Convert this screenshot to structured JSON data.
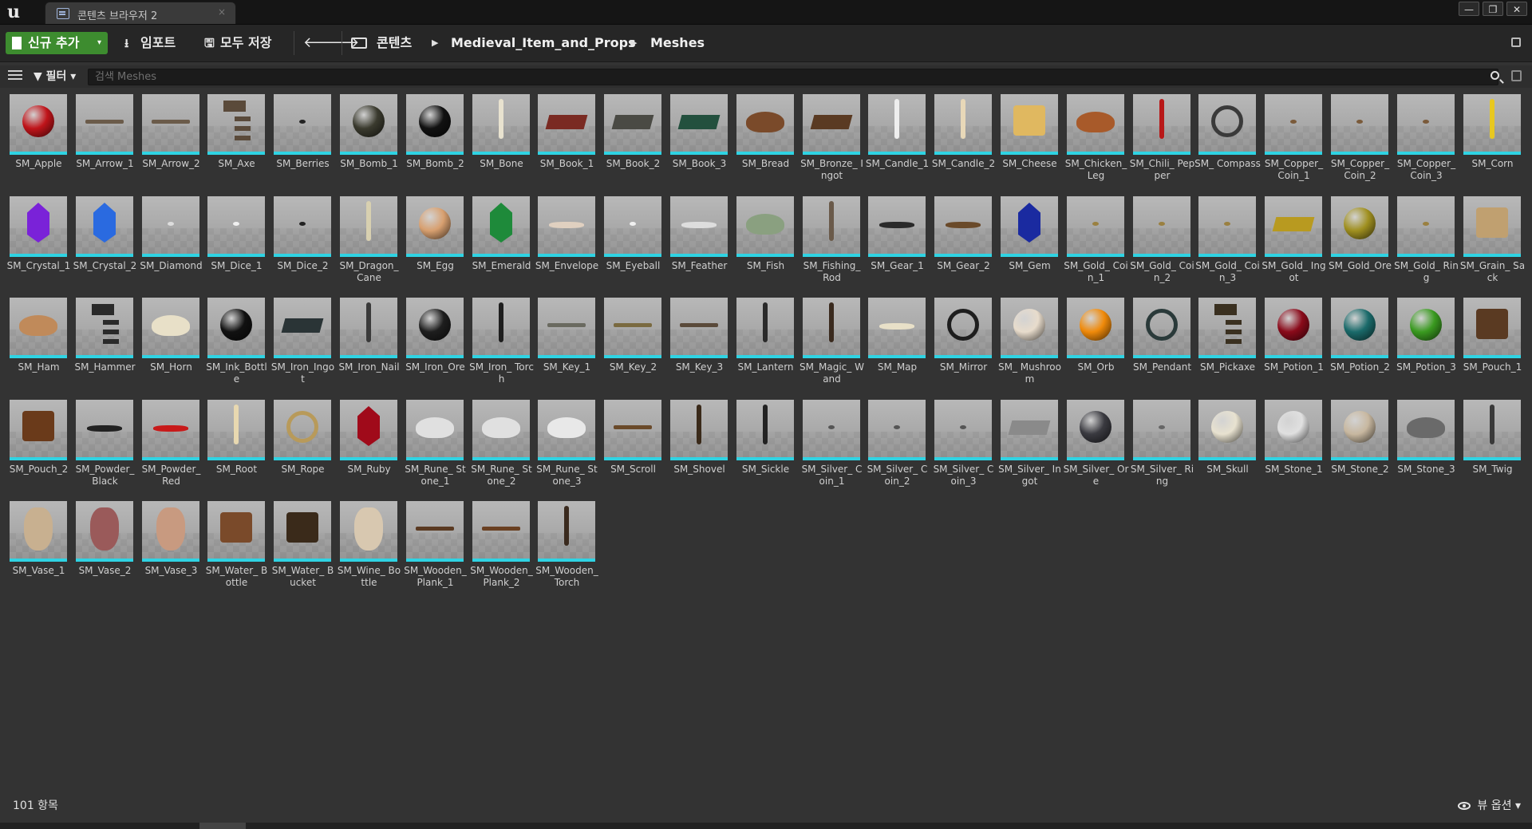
{
  "window": {
    "tab_title": "콘텐츠 브라우저 2",
    "tab_close": "×",
    "minimize": "—",
    "maximize": "❐",
    "close": "✕"
  },
  "toolbar": {
    "add_new": "신규 추가",
    "add_new_caret": "▾",
    "import": "임포트",
    "save_all": "모두 저장",
    "back": "🡐",
    "forward": "🡒",
    "breadcrumbs": [
      "콘텐츠",
      "Medieval_Item_and_Props",
      "Meshes"
    ],
    "crumb_separator": "▶"
  },
  "filter": {
    "label": "필터",
    "search_placeholder": "검색 Meshes"
  },
  "assets": [
    {
      "name": "SM_Apple",
      "shape": "ball",
      "color": "#c0141a"
    },
    {
      "name": "SM_Arrow_1",
      "shape": "stick-h",
      "color": "#6b5b4a"
    },
    {
      "name": "SM_Arrow_2",
      "shape": "stick-h",
      "color": "#6b5b4a"
    },
    {
      "name": "SM_Axe",
      "shape": "axe",
      "color": "#5a4a3a"
    },
    {
      "name": "SM_Berries",
      "shape": "tiny",
      "color": "#222222"
    },
    {
      "name": "SM_Bomb_1",
      "shape": "ball",
      "color": "#3a3a2e"
    },
    {
      "name": "SM_Bomb_2",
      "shape": "ball",
      "color": "#111111"
    },
    {
      "name": "SM_Bone",
      "shape": "stick-v",
      "color": "#e8e2cf"
    },
    {
      "name": "SM_Book_1",
      "shape": "slab",
      "color": "#7a2a22"
    },
    {
      "name": "SM_Book_2",
      "shape": "slab",
      "color": "#4a4a44"
    },
    {
      "name": "SM_Book_3",
      "shape": "slab",
      "color": "#23503e"
    },
    {
      "name": "SM_Bread",
      "shape": "loaf",
      "color": "#7a4a2a"
    },
    {
      "name": "SM_Bronze_ Ingot",
      "shape": "slab",
      "color": "#5a3a22"
    },
    {
      "name": "SM_Candle_1",
      "shape": "stick-v",
      "color": "#eeeeee"
    },
    {
      "name": "SM_Candle_2",
      "shape": "stick-v",
      "color": "#e8d8b8"
    },
    {
      "name": "SM_Cheese",
      "shape": "block",
      "color": "#e0b860"
    },
    {
      "name": "SM_Chicken_ Leg",
      "shape": "loaf",
      "color": "#a85a2a"
    },
    {
      "name": "SM_Chili_ Pepper",
      "shape": "stick-v",
      "color": "#b81818"
    },
    {
      "name": "SM_ Compass",
      "shape": "disc",
      "color": "#3a3a3a"
    },
    {
      "name": "SM_Copper_ Coin_1",
      "shape": "tiny",
      "color": "#7a5a3a"
    },
    {
      "name": "SM_Copper_ Coin_2",
      "shape": "tiny",
      "color": "#7a5a3a"
    },
    {
      "name": "SM_Copper_ Coin_3",
      "shape": "tiny",
      "color": "#7a5a3a"
    },
    {
      "name": "SM_Corn",
      "shape": "stick-v",
      "color": "#e8c820"
    },
    {
      "name": "SM_Crystal_1",
      "shape": "gem",
      "color": "#7a22d8"
    },
    {
      "name": "SM_Crystal_2",
      "shape": "gem",
      "color": "#2a6ae0"
    },
    {
      "name": "SM_Diamond",
      "shape": "tiny",
      "color": "#dddddd"
    },
    {
      "name": "SM_Dice_1",
      "shape": "tiny",
      "color": "#f0f0f0"
    },
    {
      "name": "SM_Dice_2",
      "shape": "tiny",
      "color": "#222222"
    },
    {
      "name": "SM_Dragon_ Cane",
      "shape": "stick-v",
      "color": "#d8d0b0"
    },
    {
      "name": "SM_Egg",
      "shape": "ball",
      "color": "#d8a070"
    },
    {
      "name": "SM_Emerald",
      "shape": "gem",
      "color": "#1e8a3a"
    },
    {
      "name": "SM_Envelope",
      "shape": "flat",
      "color": "#e0d0c0"
    },
    {
      "name": "SM_Eyeball",
      "shape": "tiny",
      "color": "#f0f0f0"
    },
    {
      "name": "SM_Feather",
      "shape": "flat",
      "color": "#dddddd"
    },
    {
      "name": "SM_Fish",
      "shape": "loaf",
      "color": "#8aa080"
    },
    {
      "name": "SM_Fishing_ Rod",
      "shape": "stick-v",
      "color": "#6a5a4a"
    },
    {
      "name": "SM_Gear_1",
      "shape": "flat",
      "color": "#2a2a2a"
    },
    {
      "name": "SM_Gear_2",
      "shape": "flat",
      "color": "#6a4a2a"
    },
    {
      "name": "SM_Gem",
      "shape": "gem",
      "color": "#1a2aa0"
    },
    {
      "name": "SM_Gold_ Coin_1",
      "shape": "tiny",
      "color": "#9a8040"
    },
    {
      "name": "SM_Gold_ Coin_2",
      "shape": "tiny",
      "color": "#9a8040"
    },
    {
      "name": "SM_Gold_ Coin_3",
      "shape": "tiny",
      "color": "#9a8040"
    },
    {
      "name": "SM_Gold_ Ingot",
      "shape": "slab",
      "color": "#b89a20"
    },
    {
      "name": "SM_Gold_Ore",
      "shape": "ball",
      "color": "#a09020"
    },
    {
      "name": "SM_Gold_ Ring",
      "shape": "tiny",
      "color": "#9a8040"
    },
    {
      "name": "SM_Grain_ Sack",
      "shape": "block",
      "color": "#c0a070"
    },
    {
      "name": "SM_Ham",
      "shape": "loaf",
      "color": "#c08a5a"
    },
    {
      "name": "SM_Hammer",
      "shape": "axe",
      "color": "#2a2a2a"
    },
    {
      "name": "SM_Horn",
      "shape": "loaf",
      "color": "#e8e0c8"
    },
    {
      "name": "SM_Ink_Bottle",
      "shape": "ball",
      "color": "#111111"
    },
    {
      "name": "SM_Iron_Ingot",
      "shape": "slab",
      "color": "#2a3436"
    },
    {
      "name": "SM_Iron_Nail",
      "shape": "stick-v",
      "color": "#3a3a3a"
    },
    {
      "name": "SM_Iron_Ore",
      "shape": "ball",
      "color": "#1e1e1e"
    },
    {
      "name": "SM_Iron_ Torch",
      "shape": "stick-v",
      "color": "#1e1e1e"
    },
    {
      "name": "SM_Key_1",
      "shape": "stick-h",
      "color": "#6a6a60"
    },
    {
      "name": "SM_Key_2",
      "shape": "stick-h",
      "color": "#7a6a40"
    },
    {
      "name": "SM_Key_3",
      "shape": "stick-h",
      "color": "#5a4a3a"
    },
    {
      "name": "SM_Lantern",
      "shape": "stick-v",
      "color": "#2a2a2a"
    },
    {
      "name": "SM_Magic_ Wand",
      "shape": "stick-v",
      "color": "#3a2a1e"
    },
    {
      "name": "SM_Map",
      "shape": "flat",
      "color": "#e8e0c8"
    },
    {
      "name": "SM_Mirror",
      "shape": "disc",
      "color": "#1e1e1e"
    },
    {
      "name": "SM_ Mushroom",
      "shape": "ball",
      "color": "#e8dccc"
    },
    {
      "name": "SM_Orb",
      "shape": "ball",
      "color": "#f08a0a"
    },
    {
      "name": "SM_Pendant",
      "shape": "disc",
      "color": "#2a3a3a"
    },
    {
      "name": "SM_Pickaxe",
      "shape": "axe",
      "color": "#3a3020"
    },
    {
      "name": "SM_Potion_1",
      "shape": "ball",
      "color": "#8a0a1a"
    },
    {
      "name": "SM_Potion_2",
      "shape": "ball",
      "color": "#1a6a6a"
    },
    {
      "name": "SM_Potion_3",
      "shape": "ball",
      "color": "#3a9a20"
    },
    {
      "name": "SM_Pouch_1",
      "shape": "block",
      "color": "#5a3a22"
    },
    {
      "name": "SM_Pouch_2",
      "shape": "block",
      "color": "#6a3a1a"
    },
    {
      "name": "SM_Powder_ Black",
      "shape": "flat",
      "color": "#222222"
    },
    {
      "name": "SM_Powder_ Red",
      "shape": "flat",
      "color": "#c81a1a"
    },
    {
      "name": "SM_Root",
      "shape": "stick-v",
      "color": "#e8d8b0"
    },
    {
      "name": "SM_Rope",
      "shape": "disc",
      "color": "#b89a5a"
    },
    {
      "name": "SM_Ruby",
      "shape": "gem",
      "color": "#a00a1a"
    },
    {
      "name": "SM_Rune_ Stone_1",
      "shape": "loaf",
      "color": "#e0e0e0"
    },
    {
      "name": "SM_Rune_ Stone_2",
      "shape": "loaf",
      "color": "#e0e0e0"
    },
    {
      "name": "SM_Rune_ Stone_3",
      "shape": "loaf",
      "color": "#e8e8e8"
    },
    {
      "name": "SM_Scroll",
      "shape": "stick-h",
      "color": "#6a4a2a"
    },
    {
      "name": "SM_Shovel",
      "shape": "stick-v",
      "color": "#3a2a1a"
    },
    {
      "name": "SM_Sickle",
      "shape": "stick-v",
      "color": "#222222"
    },
    {
      "name": "SM_Silver_ Coin_1",
      "shape": "tiny",
      "color": "#555555"
    },
    {
      "name": "SM_Silver_ Coin_2",
      "shape": "tiny",
      "color": "#555555"
    },
    {
      "name": "SM_Silver_ Coin_3",
      "shape": "tiny",
      "color": "#555555"
    },
    {
      "name": "SM_Silver_ Ingot",
      "shape": "slab",
      "color": "#8a8a8a"
    },
    {
      "name": "SM_Silver_ Ore",
      "shape": "ball",
      "color": "#3a3a40"
    },
    {
      "name": "SM_Silver_ Ring",
      "shape": "tiny",
      "color": "#666666"
    },
    {
      "name": "SM_Skull",
      "shape": "ball",
      "color": "#e8e2d0"
    },
    {
      "name": "SM_Stone_1",
      "shape": "ball",
      "color": "#e0e0e0"
    },
    {
      "name": "SM_Stone_2",
      "shape": "ball",
      "color": "#c8b8a0"
    },
    {
      "name": "SM_Stone_3",
      "shape": "loaf",
      "color": "#6a6a6a"
    },
    {
      "name": "SM_Twig",
      "shape": "stick-v",
      "color": "#3a3a3a"
    },
    {
      "name": "SM_Vase_1",
      "shape": "vase",
      "color": "#c8b090"
    },
    {
      "name": "SM_Vase_2",
      "shape": "vase",
      "color": "#9a5a5a"
    },
    {
      "name": "SM_Vase_3",
      "shape": "vase",
      "color": "#c89a80"
    },
    {
      "name": "SM_Water_ Bottle",
      "shape": "block",
      "color": "#7a4a2a"
    },
    {
      "name": "SM_Water_ Bucket",
      "shape": "block",
      "color": "#3a2a1a"
    },
    {
      "name": "SM_Wine_ Bottle",
      "shape": "vase",
      "color": "#d8c8b0"
    },
    {
      "name": "SM_Wooden_ Plank_1",
      "shape": "stick-h",
      "color": "#5a3a22"
    },
    {
      "name": "SM_Wooden_ Plank_2",
      "shape": "stick-h",
      "color": "#6a4022"
    },
    {
      "name": "SM_Wooden_ Torch",
      "shape": "stick-v",
      "color": "#3a2a1e"
    }
  ],
  "status": {
    "item_count": "101 항목",
    "view_options": "뷰 옵션",
    "view_caret": "▾"
  },
  "colors": {
    "accent_green": "#3d8c2f",
    "asset_type_bar": "#2fd3e3"
  }
}
